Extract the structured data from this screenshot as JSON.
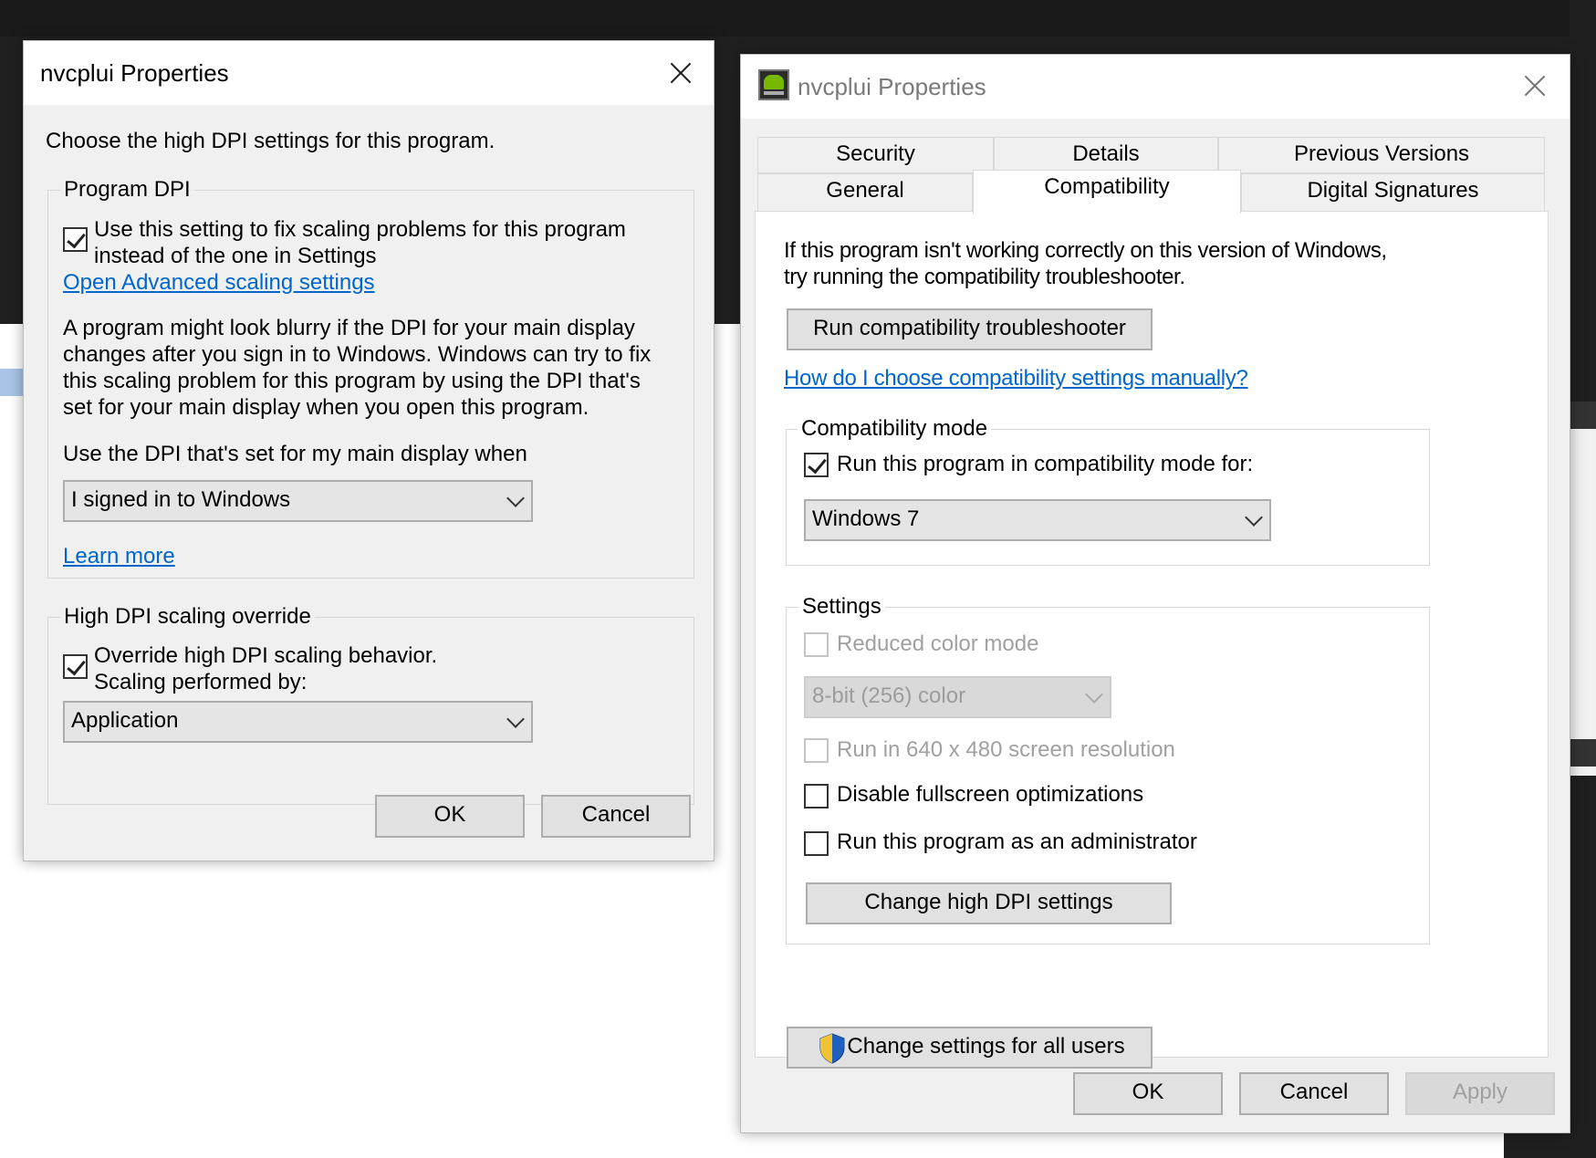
{
  "left_dialog": {
    "title": "nvcplui Properties",
    "heading": "Choose the high DPI settings for this program.",
    "program_dpi": {
      "title": "Program DPI",
      "checkbox_line1": "Use this setting to fix scaling problems for this program",
      "checkbox_line2": "instead of the one in Settings",
      "checked": true,
      "advanced_link": "Open Advanced scaling settings",
      "para_line1": "A program might look blurry if the DPI for your main display",
      "para_line2": "changes after you sign in to Windows. Windows can try to fix",
      "para_line3": "this scaling problem for this program by using the DPI that's",
      "para_line4": "set for your main display when you open this program.",
      "when_label": "Use the DPI that's set for my main display when",
      "when_value": "I signed in to Windows",
      "learn_more": "Learn more"
    },
    "override": {
      "title": "High DPI scaling override",
      "checkbox_line1": "Override high DPI scaling behavior.",
      "checkbox_line2": "Scaling performed by:",
      "checked": true,
      "scaling_value": "Application"
    },
    "ok": "OK",
    "cancel": "Cancel"
  },
  "right_dialog": {
    "title": "nvcplui Properties",
    "tabs_row1": [
      "Security",
      "Details",
      "Previous Versions"
    ],
    "tabs_row2": [
      "General",
      "Compatibility",
      "Digital Signatures"
    ],
    "active_tab": "Compatibility",
    "intro_line1": "If this program isn't working correctly on this version of Windows,",
    "intro_line2": "try running the compatibility troubleshooter.",
    "run_troubleshooter": "Run compatibility troubleshooter",
    "manual_link": "How do I choose compatibility settings manually?",
    "compat_mode": {
      "title": "Compatibility mode",
      "checkbox": "Run this program in compatibility mode for:",
      "checked": true,
      "os_value": "Windows 7"
    },
    "settings": {
      "title": "Settings",
      "reduced_color": "Reduced color mode",
      "color_value": "8-bit (256) color",
      "run_640": "Run in 640 x 480 screen resolution",
      "disable_fullscreen": "Disable fullscreen optimizations",
      "run_admin": "Run this program as an administrator",
      "change_dpi": "Change high DPI settings"
    },
    "change_all_users": "Change settings for all users",
    "ok": "OK",
    "cancel": "Cancel",
    "apply": "Apply"
  },
  "colors": {
    "link": "#0066cc",
    "dialog_bg": "#f0f0f0",
    "desktop_dark": "#202020"
  }
}
